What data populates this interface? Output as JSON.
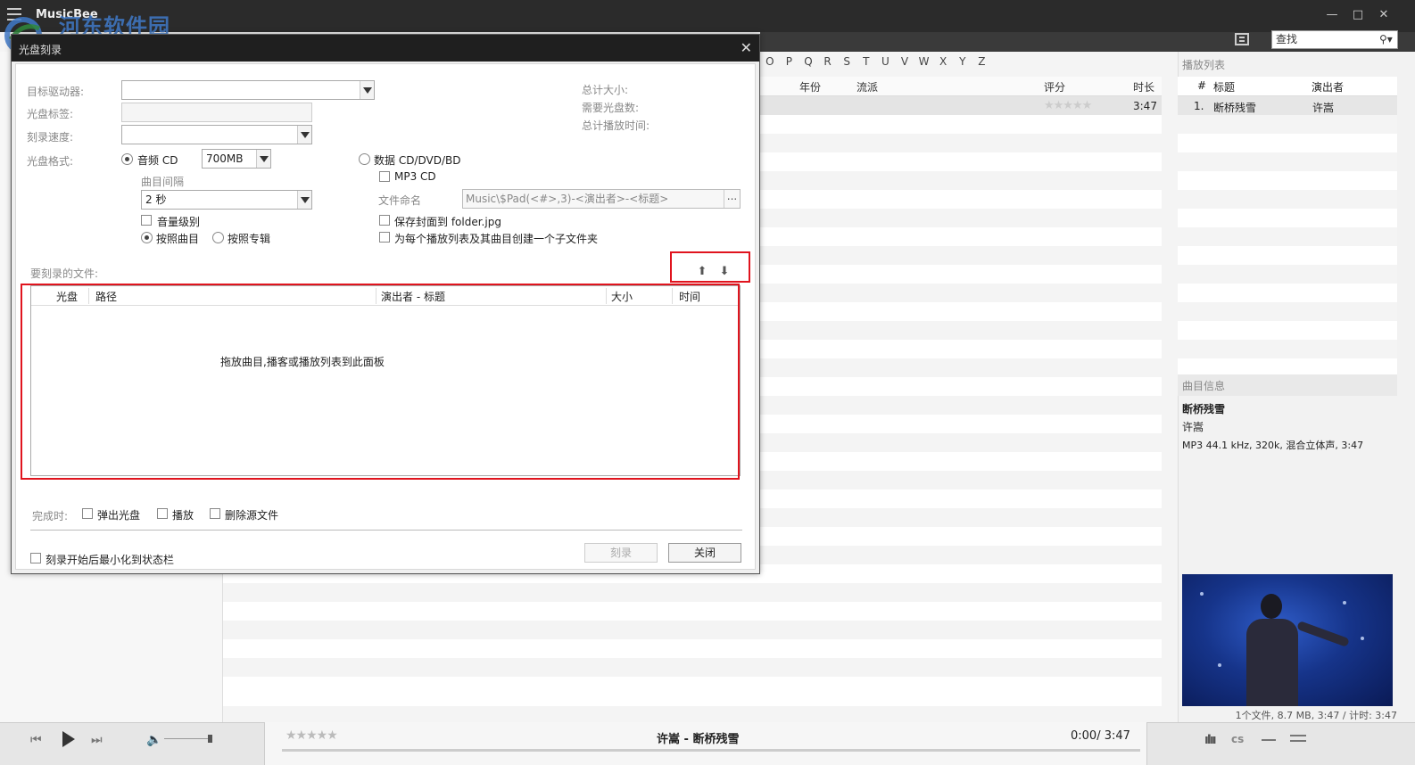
{
  "app": {
    "title": "MusicBee",
    "watermark_text": "河东软件园",
    "watermark_url": "www.pc0359.cn"
  },
  "search": {
    "placeholder": "查找"
  },
  "alphabet": [
    "O",
    "P",
    "Q",
    "R",
    "S",
    "T",
    "U",
    "V",
    "W",
    "X",
    "Y",
    "Z"
  ],
  "track_list": {
    "columns": [
      "年份",
      "流派",
      "评分",
      "时长"
    ],
    "row": {
      "rating": "★★★★★",
      "duration": "3:47"
    }
  },
  "playlist": {
    "label": "播放列表",
    "columns": [
      "#",
      "标题",
      "演出者"
    ],
    "items": [
      {
        "num": "1.",
        "title": "断桥残雪",
        "artist": "许嵩"
      }
    ]
  },
  "track_info": {
    "label": "曲目信息",
    "title": "断桥残雪",
    "artist": "许嵩",
    "format": "MP3 44.1 kHz, 320k, 混合立体声, 3:47"
  },
  "status_bar": "1个文件, 8.7 MB, 3:47 /    计时: 3:47",
  "player": {
    "rating": "★★★★★",
    "now_playing": "许嵩 - 断桥残雪",
    "time": "0:00/ 3:47",
    "volume_level": 0.95
  },
  "dialog": {
    "title": "光盘刻录",
    "labels": {
      "target_drive": "目标驱动器:",
      "disc_label": "光盘标签:",
      "burn_speed": "刻录速度:",
      "disc_format": "光盘格式:",
      "track_gap": "曲目间隔",
      "file_naming": "文件命名",
      "total_size": "总计大小:",
      "discs_needed": "需要光盘数:",
      "total_time": "总计播放时间:",
      "files_to_burn": "要刻录的文件:",
      "on_complete": "完成时:"
    },
    "options": {
      "audio_cd": "音频 CD",
      "audio_size": "700MB",
      "gap_value": "2 秒",
      "volume_level": "音量级别",
      "by_track": "按照曲目",
      "by_album": "按照专辑",
      "data_disc": "数据 CD/DVD/BD",
      "mp3_cd": "MP3 CD",
      "file_naming_value": "Music\\$Pad(<#>,3)-<演出者>-<标题>",
      "ellipsis": "...",
      "save_cover": "保存封面到 folder.jpg",
      "subfolder": "为每个播放列表及其曲目创建一个子文件夹",
      "eject": "弹出光盘",
      "play": "播放",
      "delete_source": "删除源文件",
      "minimize": "刻录开始后最小化到状态栏"
    },
    "file_columns": [
      "光盘",
      "路径",
      "演出者 - 标题",
      "大小",
      "时间"
    ],
    "empty_hint": "拖放曲目,播客或播放列表到此面板",
    "buttons": {
      "burn": "刻录",
      "close": "关闭"
    }
  }
}
